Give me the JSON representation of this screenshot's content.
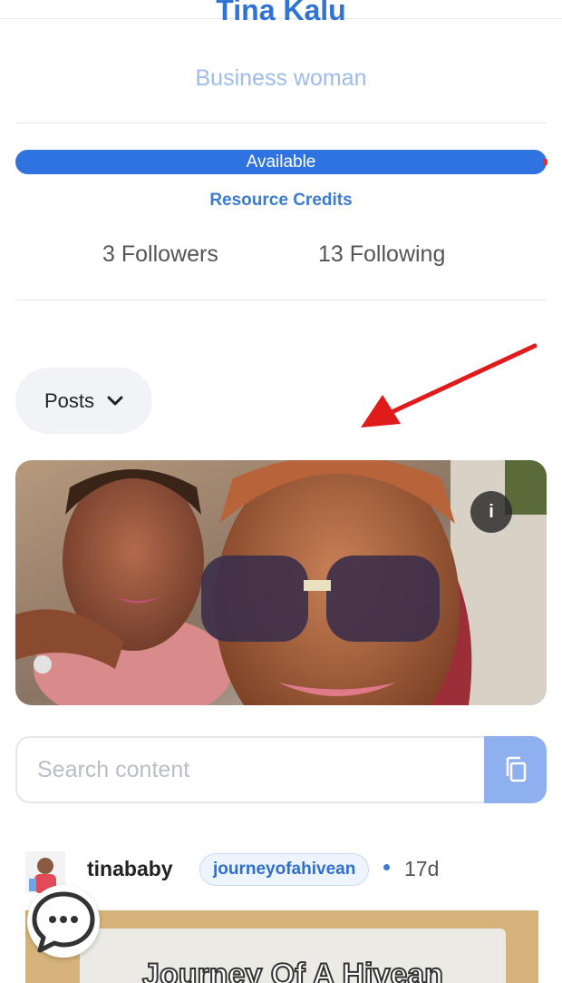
{
  "profile": {
    "name": "Tina Kalu",
    "bio": "Business woman",
    "availability": "Available",
    "resource_credits_label": "Resource Credits",
    "followers": "3 Followers",
    "following": "13 Following"
  },
  "filter": {
    "selected": "Posts"
  },
  "search": {
    "placeholder": "Search content"
  },
  "post": {
    "username": "tinababy",
    "community_tag": "journeyofahivean",
    "age": "17d",
    "image_text": "Journey Of A Hivean"
  },
  "icons": {
    "info": "info-icon",
    "copy": "copy-icon",
    "chevron": "chevron-down-icon",
    "chat": "chat-bubble-icon",
    "annotation_arrow": "red-arrow-annotation"
  },
  "colors": {
    "accent": "#2f73e0",
    "bio_text": "#9dbcec",
    "tag_text": "#2f6fce",
    "annotation": "#e01b1b"
  }
}
